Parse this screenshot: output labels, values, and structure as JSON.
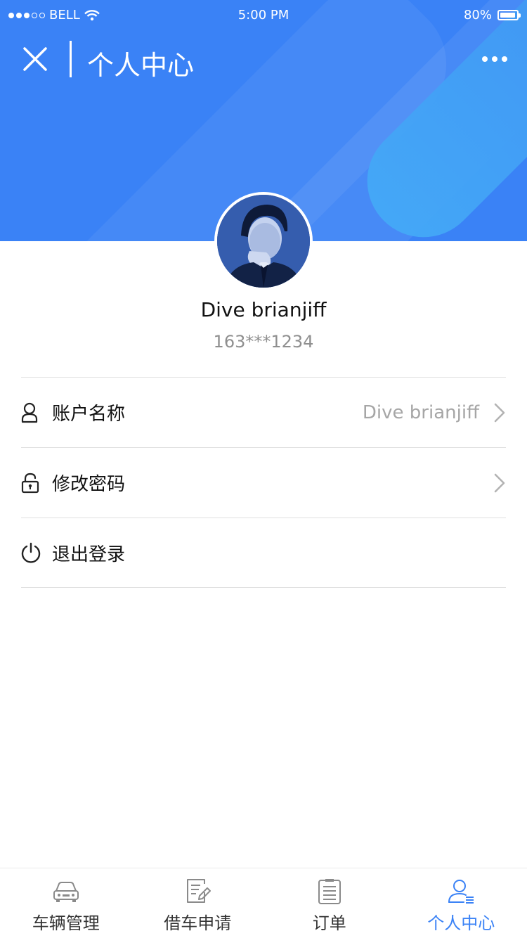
{
  "status_bar": {
    "carrier": "BELL",
    "time": "5:00 PM",
    "battery": "80%"
  },
  "navbar": {
    "title": "个人中心"
  },
  "profile": {
    "name": "Dive brianjiff",
    "phone": "163***1234"
  },
  "menu": [
    {
      "label": "账户名称",
      "value": "Dive brianjiff",
      "icon": "user-icon"
    },
    {
      "label": "修改密码",
      "value": "",
      "icon": "lock-icon"
    },
    {
      "label": "退出登录",
      "value": "",
      "icon": "power-icon"
    }
  ],
  "tabbar": [
    {
      "label": "车辆管理",
      "icon": "car-icon",
      "active": false
    },
    {
      "label": "借车申请",
      "icon": "edit-document-icon",
      "active": false
    },
    {
      "label": "订单",
      "icon": "clipboard-icon",
      "active": false
    },
    {
      "label": "个人中心",
      "icon": "profile-icon",
      "active": true
    }
  ],
  "colors": {
    "accent": "#3a82f6",
    "muted_text": "#8f8f8f"
  }
}
